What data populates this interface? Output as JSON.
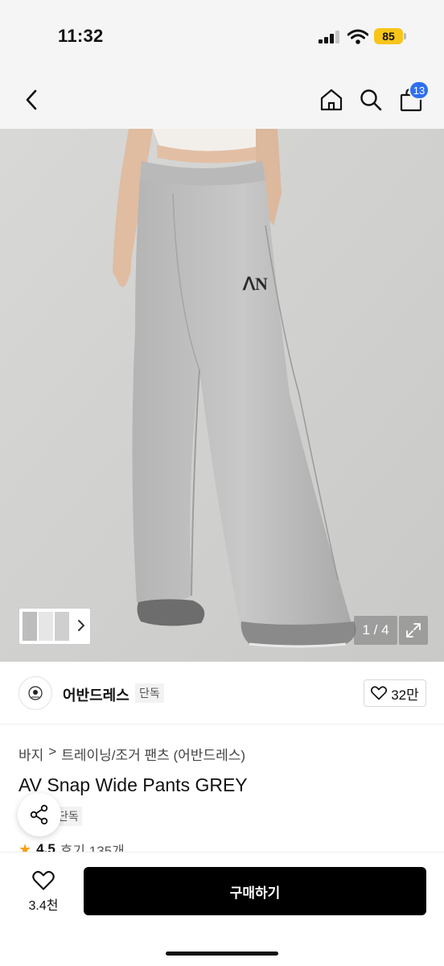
{
  "status_bar": {
    "time": "11:32",
    "battery": "85",
    "icons": [
      "signal-icon",
      "wifi-icon",
      "battery-icon"
    ]
  },
  "nav": {
    "back_icon": "chevron-left-icon",
    "home_icon": "home-icon",
    "search_icon": "search-icon",
    "cart_icon": "shopping-bag-icon",
    "cart_badge": "13",
    "accent": "#2f6ff0"
  },
  "gallery": {
    "counter": "1 / 4",
    "expand_icon": "expand-icon",
    "thumb_arrow_icon": "chevron-right-icon"
  },
  "brand": {
    "name": "어반드레스",
    "tag": "단독",
    "likes": "32만",
    "like_icon": "heart-icon"
  },
  "product": {
    "breadcrumb": [
      "바지",
      "트레이닝/조거 팬츠 (어반드레스)"
    ],
    "breadcrumb_separator": ">",
    "title": "AV Snap Wide Pants GREY",
    "exclusive_tag": "단독",
    "rating_value": "4.5",
    "review_text": "후기 135개",
    "star_color": "#f4a018"
  },
  "bottom_bar": {
    "wish_count": "3.4천",
    "buy_label": "구매하기",
    "share_icon": "share-icon",
    "heart_icon": "heart-icon"
  }
}
